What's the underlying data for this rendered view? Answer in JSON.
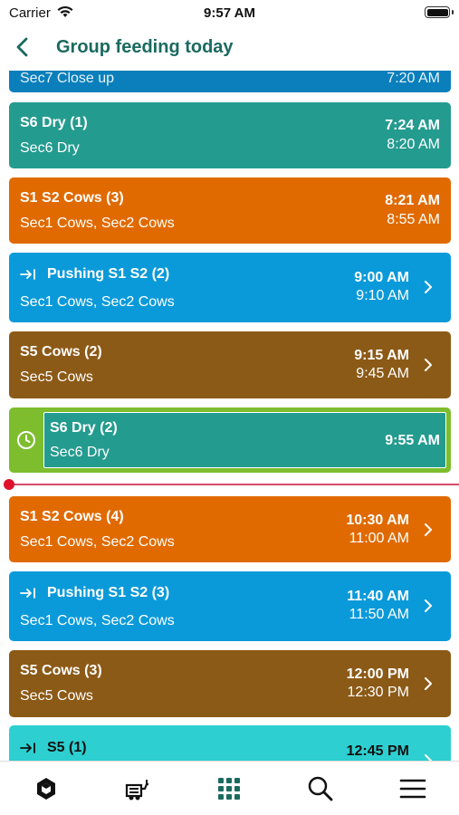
{
  "status": {
    "carrier": "Carrier",
    "time": "9:57 AM"
  },
  "nav": {
    "title": "Group feeding today",
    "back_icon": "chevron-left-icon"
  },
  "colors": {
    "dry": "#249b8f",
    "cows": "#e06a00",
    "pushing": "#0b9ad9",
    "s5": "#8c5a17",
    "s5push": "#2ecfd0",
    "closeup": "#0a7fbb",
    "current_outline": "#7dbd2e",
    "now_line": "#e0112d",
    "title": "#1a6a60"
  },
  "groups": [
    {
      "title": "",
      "subtitle": "Sec7 Close up",
      "time_start": "7:20 AM",
      "time_end": ""
    },
    {
      "title": "S6 Dry (1)",
      "subtitle": "Sec6 Dry",
      "time_start": "7:24 AM",
      "time_end": "8:20 AM"
    },
    {
      "title": "S1 S2 Cows (3)",
      "subtitle": "Sec1 Cows, Sec2 Cows",
      "time_start": "8:21 AM",
      "time_end": "8:55 AM"
    },
    {
      "title": "Pushing S1 S2 (2)",
      "subtitle": "Sec1 Cows, Sec2 Cows",
      "time_start": "9:00 AM",
      "time_end": "9:10 AM"
    },
    {
      "title": "S5 Cows (2)",
      "subtitle": "Sec5 Cows",
      "time_start": "9:15 AM",
      "time_end": "9:45 AM"
    },
    {
      "title": "S6 Dry (2)",
      "subtitle": "Sec6 Dry",
      "time_start": "9:55 AM",
      "time_end": ""
    },
    {
      "title": "S1 S2 Cows (4)",
      "subtitle": "Sec1 Cows, Sec2 Cows",
      "time_start": "10:30 AM",
      "time_end": "11:00 AM"
    },
    {
      "title": "Pushing S1 S2 (3)",
      "subtitle": "Sec1 Cows, Sec2 Cows",
      "time_start": "11:40 AM",
      "time_end": "11:50 AM"
    },
    {
      "title": "S5 Cows (3)",
      "subtitle": "Sec5 Cows",
      "time_start": "12:00 PM",
      "time_end": "12:30 PM"
    },
    {
      "title": "S5 (1)",
      "subtitle": "",
      "time_start": "12:45 PM",
      "time_end": ""
    }
  ],
  "tabs": [
    {
      "icon": "hexagon-cube-icon"
    },
    {
      "icon": "feed-wagon-icon"
    },
    {
      "icon": "grid-icon"
    },
    {
      "icon": "search-icon"
    },
    {
      "icon": "menu-icon"
    }
  ]
}
